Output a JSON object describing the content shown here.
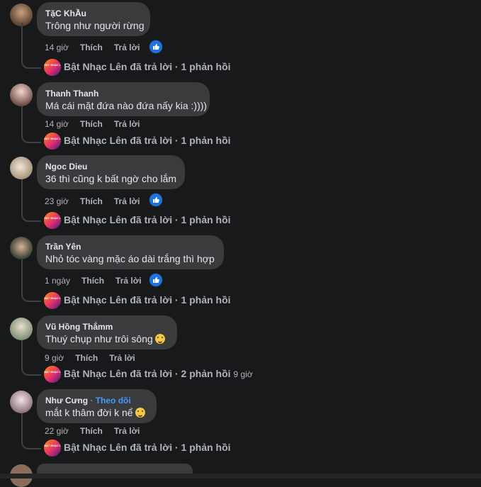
{
  "comments": [
    {
      "author": "TặC KhẦu",
      "follow": "",
      "text": "Trông như người rừng",
      "emoji": false,
      "time": "14 giờ",
      "like": "Thích",
      "reply": "Trả lời",
      "has_reaction": true,
      "replier": "Bật Nhạc Lên",
      "replies_label": "Bật Nhạc Lên đã trả lời · 1 phản hồi",
      "reply_time": ""
    },
    {
      "author": "Thanh Thanh",
      "follow": "",
      "text": "Má cái mặt đứa nào đứa nấy kia :))))",
      "emoji": false,
      "time": "14 giờ",
      "like": "Thích",
      "reply": "Trả lời",
      "has_reaction": false,
      "replier": "Bật Nhạc Lên",
      "replies_label": "Bật Nhạc Lên đã trả lời · 1 phản hồi",
      "reply_time": ""
    },
    {
      "author": "Ngoc Dieu",
      "follow": "",
      "text": "36 thì cũng k bất ngờ cho lắm",
      "emoji": false,
      "time": "23 giờ",
      "like": "Thích",
      "reply": "Trả lời",
      "has_reaction": true,
      "replier": "Bật Nhạc Lên",
      "replies_label": "Bật Nhạc Lên đã trả lời · 1 phản hồi",
      "reply_time": ""
    },
    {
      "author": "Trần Yên",
      "follow": "",
      "text": "Nhỏ tóc vàng mặc áo dài trắng thì hợp",
      "emoji": false,
      "time": "1 ngày",
      "like": "Thích",
      "reply": "Trả lời",
      "has_reaction": true,
      "replier": "Bật Nhạc Lên",
      "replies_label": "Bật Nhạc Lên đã trả lời · 1 phản hồi",
      "reply_time": ""
    },
    {
      "author": "Vũ Hồng Thắmm",
      "follow": "",
      "text": "Thuý chụp như trôi sông",
      "emoji": true,
      "time": "9 giờ",
      "like": "Thích",
      "reply": "Trả lời",
      "has_reaction": false,
      "replier": "Bật Nhạc Lên",
      "replies_label": "Bật Nhạc Lên đã trả lời · 2 phản hồi",
      "reply_time": "9 giờ"
    },
    {
      "author": "Như Cưng",
      "follow": "· Theo dõi",
      "text": "mắt k thâm đời k nể",
      "emoji": true,
      "time": "22 giờ",
      "like": "Thích",
      "reply": "Trả lời",
      "has_reaction": false,
      "replier": "Bật Nhạc Lên",
      "replies_label": "Bật Nhạc Lên đã trả lời · 1 phản hồi",
      "reply_time": ""
    }
  ],
  "page_avatar_text": "BẬT NHẠC LÊN",
  "colors": {
    "background": "#18191a",
    "bubble": "#3a3b3c",
    "like_blue": "#1b74e4",
    "follow_blue": "#4599ff",
    "muted": "#b0b3b8"
  },
  "icons": {
    "reaction": "like-icon",
    "emoji": "grinning-face-icon"
  }
}
